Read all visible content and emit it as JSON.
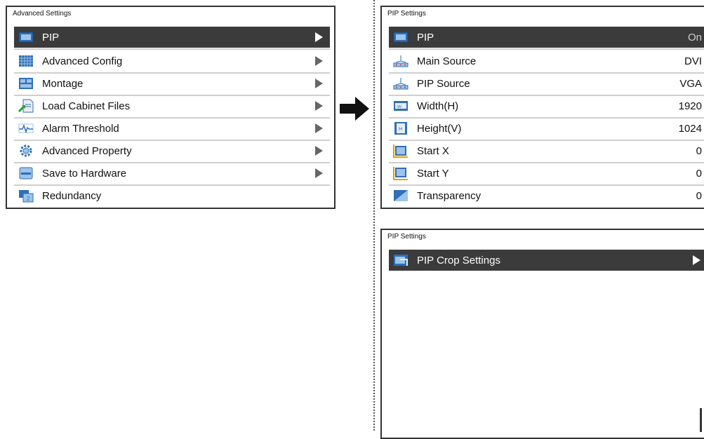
{
  "left_panel": {
    "title": "Advanced Settings",
    "items": [
      {
        "label": "PIP",
        "icon": "pip-icon"
      },
      {
        "label": "Advanced Config",
        "icon": "grid-config-icon"
      },
      {
        "label": "Montage",
        "icon": "montage-icon"
      },
      {
        "label": "Load Cabinet Files",
        "icon": "load-file-icon"
      },
      {
        "label": "Alarm Threshold",
        "icon": "alarm-waveform-icon"
      },
      {
        "label": "Advanced Property",
        "icon": "gear-icon"
      },
      {
        "label": "Save to Hardware",
        "icon": "save-hardware-icon"
      },
      {
        "label": "Redundancy",
        "icon": "redundancy-icon"
      }
    ]
  },
  "pip_panel": {
    "title": "PIP Settings",
    "items": [
      {
        "label": "PIP",
        "value": "On",
        "icon": "pip-icon"
      },
      {
        "label": "Main Source",
        "value": "DVI",
        "icon": "source-icon"
      },
      {
        "label": "PIP Source",
        "value": "VGA",
        "icon": "source-icon"
      },
      {
        "label": "Width(H)",
        "value": "1920",
        "icon": "width-icon"
      },
      {
        "label": "Height(V)",
        "value": "1024",
        "icon": "height-icon"
      },
      {
        "label": "Start X",
        "value": "0",
        "icon": "start-x-icon"
      },
      {
        "label": "Start Y",
        "value": "0",
        "icon": "start-y-icon"
      },
      {
        "label": "Transparency",
        "value": "0",
        "icon": "transparency-icon"
      }
    ]
  },
  "crop_panel": {
    "title": "PIP Settings",
    "items": [
      {
        "label": "PIP Crop Settings",
        "icon": "crop-icon"
      }
    ]
  },
  "colors": {
    "selected_bg": "#3b3b3b",
    "icon_blue": "#2f6fb5",
    "icon_light": "#9cc3ea"
  }
}
